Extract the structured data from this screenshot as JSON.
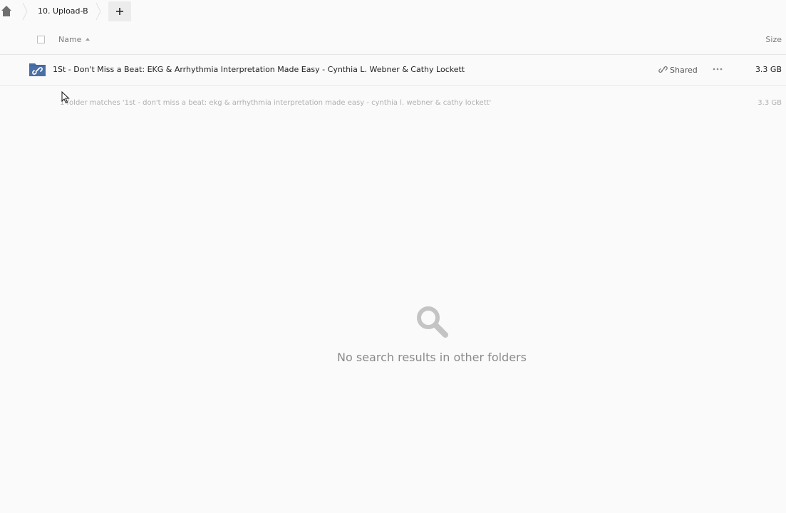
{
  "breadcrumb": {
    "home_icon": "home-icon",
    "current": "10. Upload-B",
    "add_icon": "plus-icon"
  },
  "list_header": {
    "name_label": "Name",
    "size_label": "Size",
    "sort_direction": "ascending"
  },
  "files": [
    {
      "icon": "shared-folder-icon",
      "name": "1St - Don't Miss a Beat: EKG & Arrhythmia Interpretation Made Easy - Cynthia L. Webner & Cathy Lockett",
      "share_label": "Shared",
      "size": "3.3 GB"
    }
  ],
  "summary": {
    "text": "1 folder matches '1st - don't miss a beat: ekg & arrhythmia interpretation made easy - cynthia l. webner & cathy lockett'",
    "size": "3.3 GB"
  },
  "empty_state": {
    "icon": "search-icon",
    "message": "No search results in other folders"
  },
  "colors": {
    "background": "#fafafa",
    "folder_icon": "#4a6fa5",
    "muted_text": "#b0b0b0"
  }
}
